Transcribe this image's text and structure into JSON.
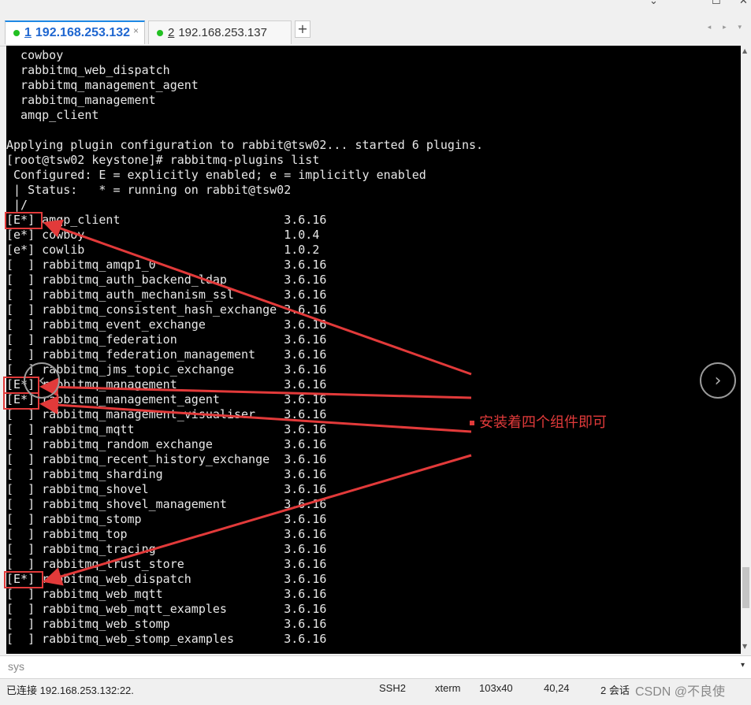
{
  "window": {
    "controls": [
      "⌄",
      "☐",
      "✕"
    ]
  },
  "tabs": [
    {
      "num": "1",
      "label": " 192.168.253.132",
      "close": "×"
    },
    {
      "num": "2",
      "label": " 192.168.253.137",
      "close": ""
    }
  ],
  "add_tab": "+",
  "tab_nav": "◂ ▸ ▾",
  "terminal": {
    "lines": [
      "  cowboy",
      "  rabbitmq_web_dispatch",
      "  rabbitmq_management_agent",
      "  rabbitmq_management",
      "  amqp_client",
      "",
      "Applying plugin configuration to rabbit@tsw02... started 6 plugins.",
      "[root@tsw02 keystone]# rabbitmq-plugins list",
      " Configured: E = explicitly enabled; e = implicitly enabled",
      " | Status:   * = running on rabbit@tsw02",
      " |/",
      "[E*] amqp_client                       3.6.16",
      "[e*] cowboy                            1.0.4",
      "[e*] cowlib                            1.0.2",
      "[  ] rabbitmq_amqp1_0                  3.6.16",
      "[  ] rabbitmq_auth_backend_ldap        3.6.16",
      "[  ] rabbitmq_auth_mechanism_ssl       3.6.16",
      "[  ] rabbitmq_consistent_hash_exchange 3.6.16",
      "[  ] rabbitmq_event_exchange           3.6.16",
      "[  ] rabbitmq_federation               3.6.16",
      "[  ] rabbitmq_federation_management    3.6.16",
      "[  ] rabbitmq_jms_topic_exchange       3.6.16",
      "[E*] rabbitmq_management               3.6.16",
      "[E*] rabbitmq_management_agent         3.6.16",
      "[  ] rabbitmq_management_visualiser    3.6.16",
      "[  ] rabbitmq_mqtt                     3.6.16",
      "[  ] rabbitmq_random_exchange          3.6.16",
      "[  ] rabbitmq_recent_history_exchange  3.6.16",
      "[  ] rabbitmq_sharding                 3.6.16",
      "[  ] rabbitmq_shovel                   3.6.16",
      "[  ] rabbitmq_shovel_management        3.6.16",
      "[  ] rabbitmq_stomp                    3.6.16",
      "[  ] rabbitmq_top                      3.6.16",
      "[  ] rabbitmq_tracing                  3.6.16",
      "[  ] rabbitmq_trust_store              3.6.16",
      "[E*] rabbitmq_web_dispatch             3.6.16",
      "[  ] rabbitmq_web_mqtt                 3.6.16",
      "[  ] rabbitmq_web_mqtt_examples        3.6.16",
      "[  ] rabbitmq_web_stomp                3.6.16",
      "[  ] rabbitmq_web_stomp_examples       3.6.16"
    ]
  },
  "annotation": "安装着四个组件即可",
  "nav": {
    "prev": "‹",
    "next": "›"
  },
  "scroll_arrows": {
    "up": "▲",
    "down": "▼"
  },
  "command_bar": {
    "text": "sys",
    "dropdown": "▾"
  },
  "status_bar": {
    "connection": "已连接 192.168.253.132:22.",
    "protocol": "SSH2",
    "term": "xterm",
    "size": "103x40",
    "cursor": "40,24",
    "sessions": "2 会话",
    "watermark": "CSDN @不良使"
  },
  "colors": {
    "highlight": "#e23a3a",
    "tab_active": "#1e66d0"
  }
}
